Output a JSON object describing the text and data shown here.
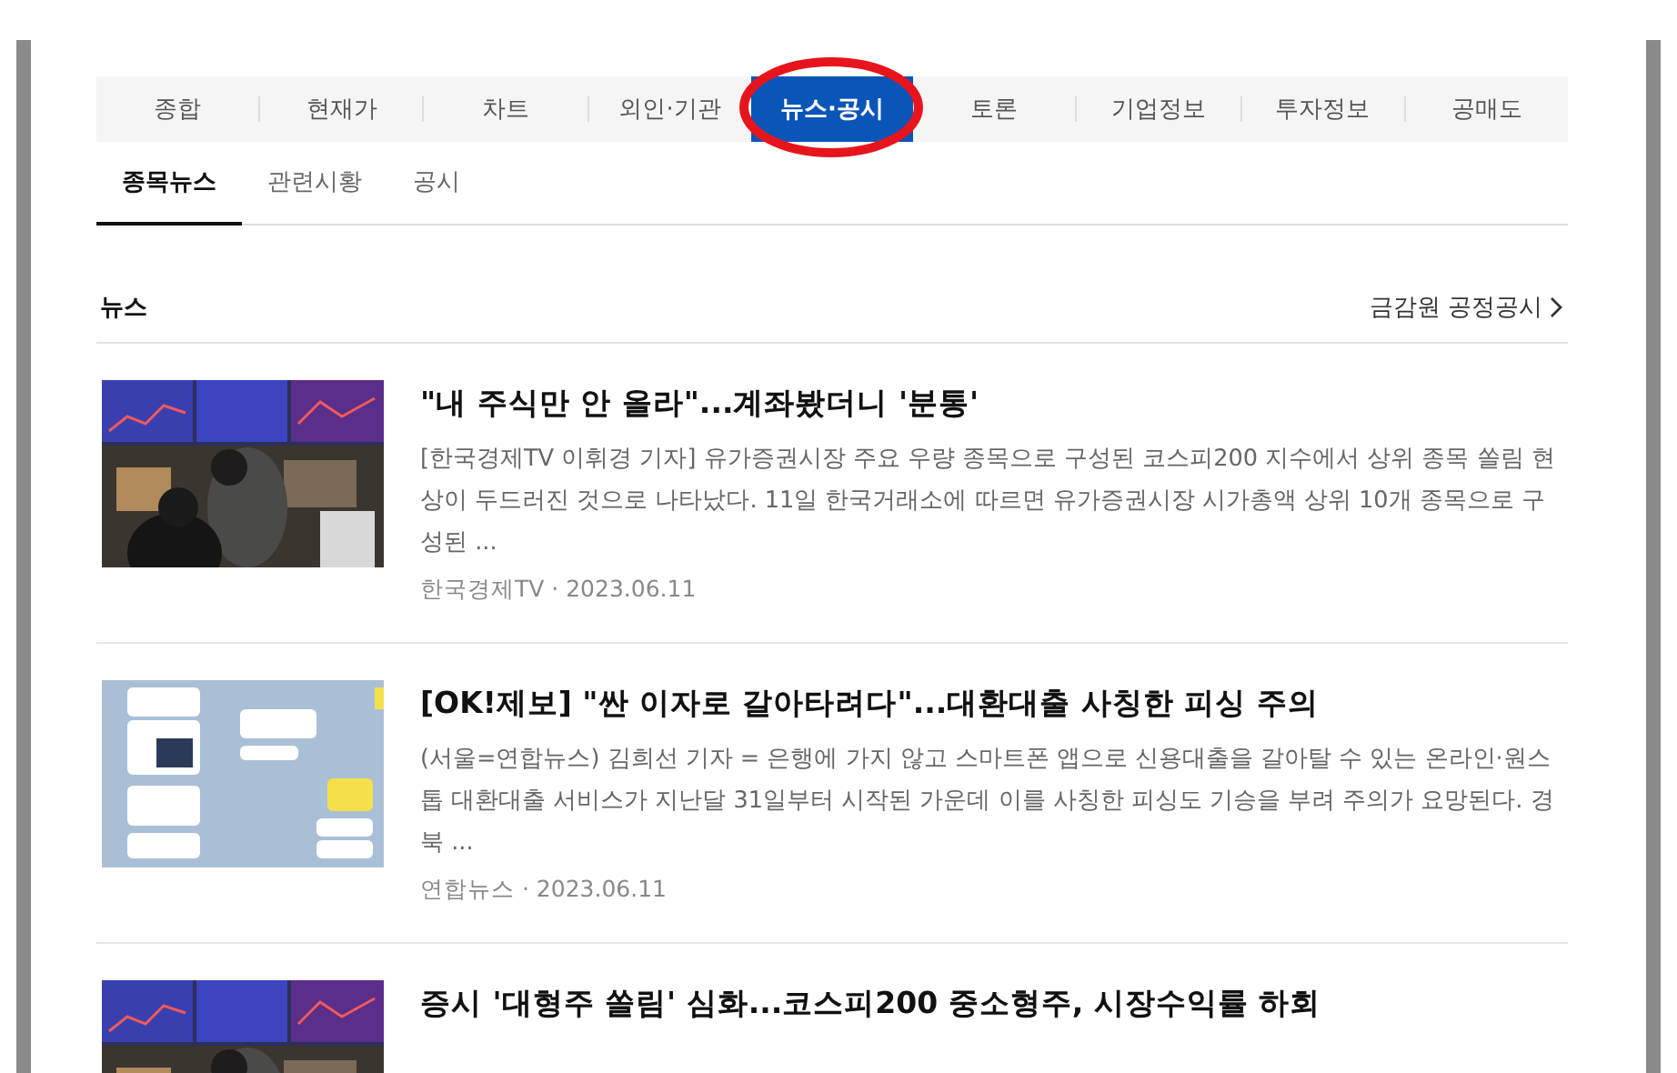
{
  "tabs": [
    {
      "label": "종합",
      "selected": false
    },
    {
      "label": "현재가",
      "selected": false
    },
    {
      "label": "차트",
      "selected": false
    },
    {
      "label": "외인·기관",
      "selected": false
    },
    {
      "label": "뉴스·공시",
      "selected": true
    },
    {
      "label": "토론",
      "selected": false
    },
    {
      "label": "기업정보",
      "selected": false
    },
    {
      "label": "투자정보",
      "selected": false
    },
    {
      "label": "공매도",
      "selected": false
    }
  ],
  "subtabs": [
    {
      "label": "종목뉴스",
      "selected": true
    },
    {
      "label": "관련시황",
      "selected": false
    },
    {
      "label": "공시",
      "selected": false
    }
  ],
  "section": {
    "title": "뉴스",
    "link": "금감원 공정공시"
  },
  "articles": [
    {
      "kind": "picture",
      "title": "\"내 주식만 안 올라\"...계좌봤더니 '분통'",
      "summary": "[한국경제TV 이휘경 기자] 유가증권시장 주요 우량 종목으로 구성된 코스피200 지수에서 상위 종목 쏠림 현상이 두드러진 것으로 나타났다. 11일 한국거래소에 따르면 유가증권시장 시가총액 상위 10개 종목으로 구성된 ...",
      "source": "한국경제TV · 2023.06.11"
    },
    {
      "kind": "chat",
      "title": "[OK!제보] \"싼 이자로 갈아타려다\"...대환대출 사칭한 피싱 주의",
      "summary": "(서울=연합뉴스) 김희선 기자 = 은행에 가지 않고 스마트폰 앱으로 신용대출을 갈아탈 수 있는 온라인·원스톱 대환대출 서비스가 지난달 31일부터 시작된 가운데 이를 사칭한 피싱도 기승을 부려 주의가 요망된다. 경북 ...",
      "source": "연합뉴스 · 2023.06.11"
    },
    {
      "kind": "picture",
      "title": "증시 '대형주 쏠림' 심화...코스피200 중소형주, 시장수익률 하회"
    }
  ]
}
